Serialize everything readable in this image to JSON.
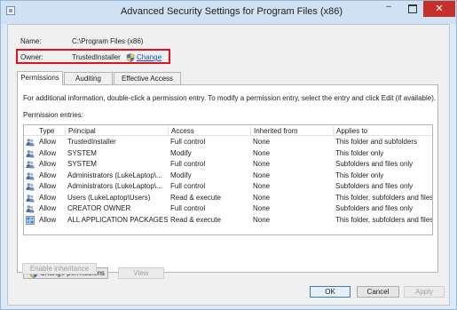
{
  "window": {
    "title": "Advanced Security Settings for Program Files (x86)",
    "controls": {
      "minimize": "–",
      "close": "✕"
    }
  },
  "info": {
    "name_label": "Name:",
    "name_value": "C:\\Program Files (x86)",
    "owner_label": "Owner:",
    "owner_value": "TrustedInstaller",
    "change_link": "Change"
  },
  "tabs": [
    {
      "label": "Permissions",
      "active": true
    },
    {
      "label": "Auditing",
      "active": false
    },
    {
      "label": "Effective Access",
      "active": false
    }
  ],
  "permissions": {
    "instructions": "For additional information, double-click a permission entry. To modify a permission entry, select the entry and click Edit (if available).",
    "entries_label": "Permission entries:",
    "columns": [
      "Type",
      "Principal",
      "Access",
      "Inherited from",
      "Applies to"
    ],
    "rows": [
      {
        "icon": "users-icon",
        "type": "Allow",
        "principal": "TrustedInstaller",
        "access": "Full control",
        "inherited": "None",
        "applies": "This folder and subfolders"
      },
      {
        "icon": "users-icon",
        "type": "Allow",
        "principal": "SYSTEM",
        "access": "Modify",
        "inherited": "None",
        "applies": "This folder only"
      },
      {
        "icon": "users-icon",
        "type": "Allow",
        "principal": "SYSTEM",
        "access": "Full control",
        "inherited": "None",
        "applies": "Subfolders and files only"
      },
      {
        "icon": "users-icon",
        "type": "Allow",
        "principal": "Administrators (LukeLaptop\\...",
        "access": "Modify",
        "inherited": "None",
        "applies": "This folder only"
      },
      {
        "icon": "users-icon",
        "type": "Allow",
        "principal": "Administrators (LukeLaptop\\...",
        "access": "Full control",
        "inherited": "None",
        "applies": "Subfolders and files only"
      },
      {
        "icon": "users-icon",
        "type": "Allow",
        "principal": "Users (LukeLaptop\\Users)",
        "access": "Read & execute",
        "inherited": "None",
        "applies": "This folder, subfolders and files"
      },
      {
        "icon": "users-icon",
        "type": "Allow",
        "principal": "CREATOR OWNER",
        "access": "Full control",
        "inherited": "None",
        "applies": "Subfolders and files only"
      },
      {
        "icon": "packages-icon",
        "type": "Allow",
        "principal": "ALL APPLICATION PACKAGES",
        "access": "Read & execute",
        "inherited": "None",
        "applies": "This folder, subfolders and files"
      }
    ],
    "change_permissions_label": "Change permissions",
    "view_label": "View",
    "enable_inheritance_label": "Enable inheritance"
  },
  "footer": {
    "ok": "OK",
    "cancel": "Cancel",
    "apply": "Apply"
  },
  "colors": {
    "highlight_box": "#e1121d",
    "link": "#0a55c2",
    "close_button": "#c7302a"
  }
}
